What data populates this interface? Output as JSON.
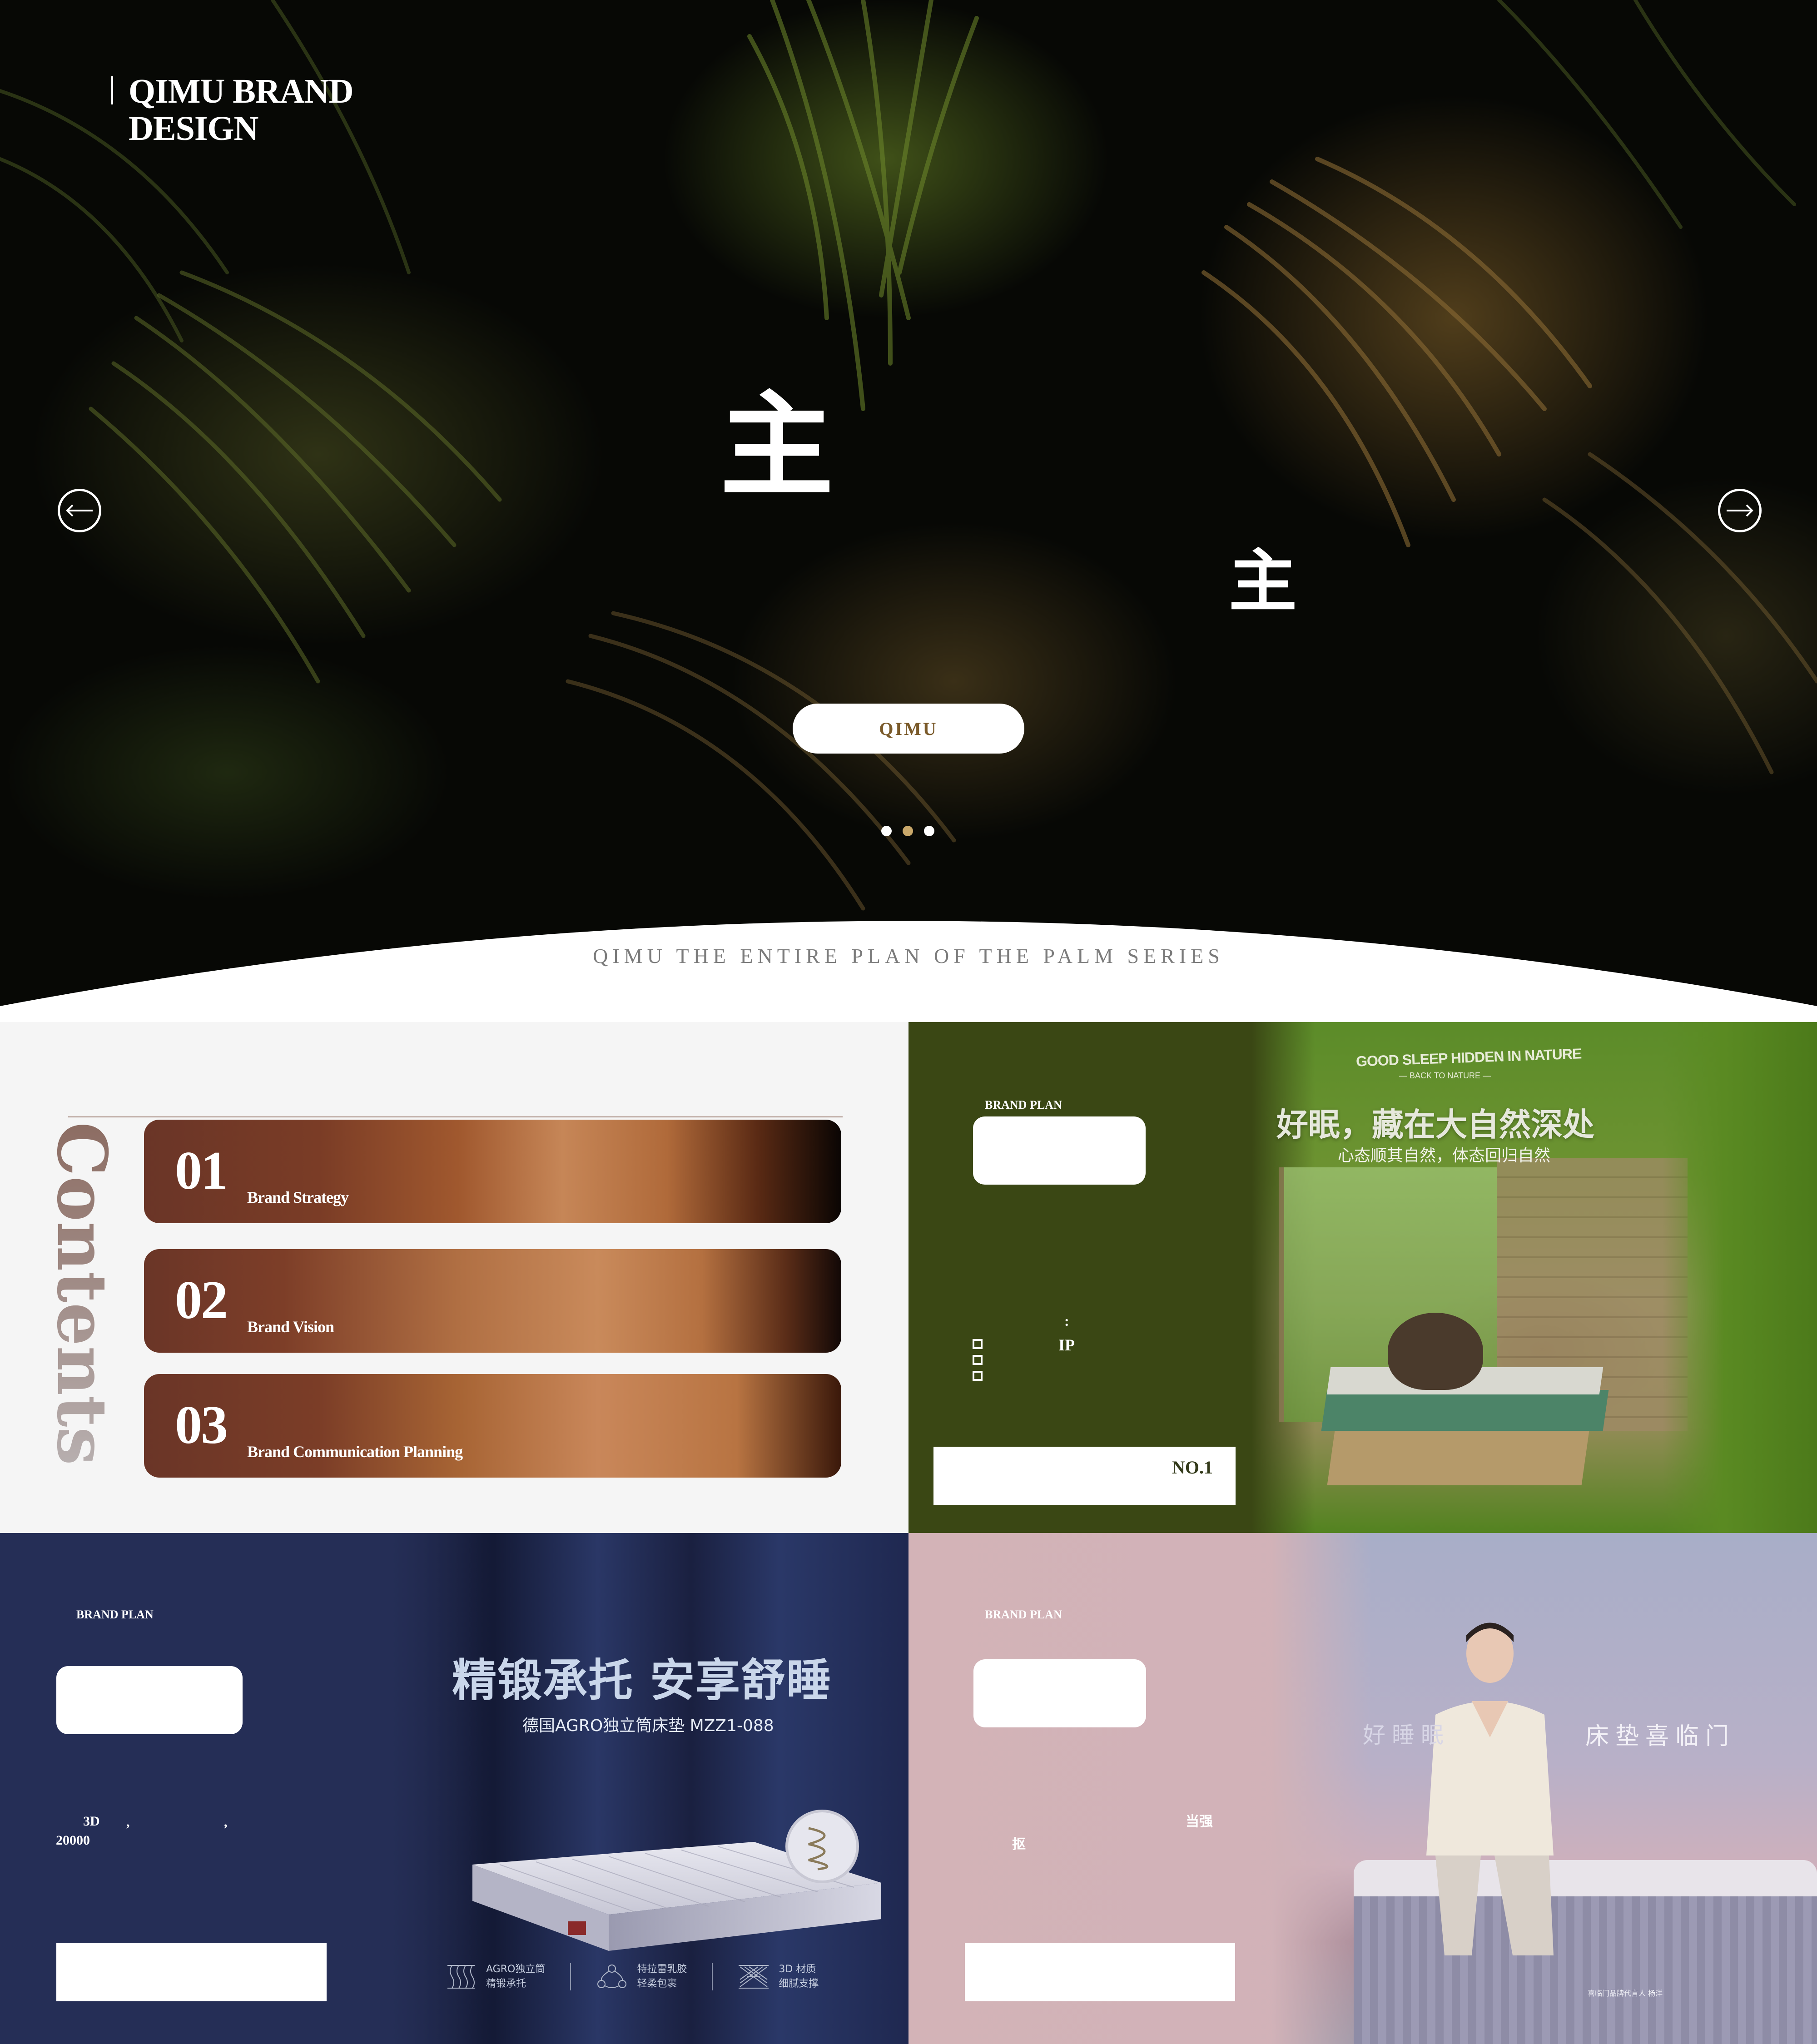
{
  "hero": {
    "brand_title_line1": "QIMU BRAND",
    "brand_title_line2": "DESIGN",
    "char_large": "主",
    "char_small": "主",
    "cta_label": "QIMU",
    "prev_icon": "arrow-left-icon",
    "next_icon": "arrow-right-icon",
    "dots": [
      {
        "active": false
      },
      {
        "active": true
      },
      {
        "active": false
      }
    ],
    "dot_active_color": "#c9a86a",
    "series_title": "QIMU THE ENTIRE PLAN OF THE PALM SERIES"
  },
  "contents": {
    "vertical_title": "Contents",
    "items": [
      {
        "num": "01",
        "label": "Brand Strategy"
      },
      {
        "num": "02",
        "label": "Brand Vision"
      },
      {
        "num": "03",
        "label": "Brand Communication Planning"
      }
    ],
    "accent_color": "#6a3527"
  },
  "green_panel": {
    "label": "BRAND PLAN",
    "colon": ":",
    "ip": "IP",
    "bar_text": "NO.1",
    "bg_color": "#3a4714",
    "photo": {
      "headline_en": "GOOD SLEEP HIDDEN IN NATURE",
      "sub_en": "— BACK TO NATURE —",
      "headline_cn": "好眠，藏在大自然深处",
      "sub_cn": "心态顺其自然，体态回归自然"
    }
  },
  "blue_panel": {
    "label": "BRAND PLAN",
    "line1": "3D",
    "line2": "20000",
    "comma1": ",",
    "comma2": ",",
    "bg_color": "#252e56",
    "photo": {
      "headline_cn": "精锻承托 安享舒睡",
      "sub_cn": "德国AGRO独立筒床垫 MZZ1-088",
      "features": [
        {
          "icon": "spring-icon",
          "line1": "AGRO独立筒",
          "line2": "精锻承托"
        },
        {
          "icon": "latex-icon",
          "line1": "特拉雷乳胶",
          "line2": "轻柔包裹"
        },
        {
          "icon": "mesh-3d-icon",
          "line1": "3D 材质",
          "line2": "细腻支撑"
        }
      ]
    }
  },
  "pink_panel": {
    "label": "BRAND PLAN",
    "text1": "当强",
    "text2": "抠",
    "photo": {
      "left_text": "好睡眠",
      "right_text": "床垫喜临门",
      "caption": "喜临门品牌代言人 杨洋"
    }
  }
}
